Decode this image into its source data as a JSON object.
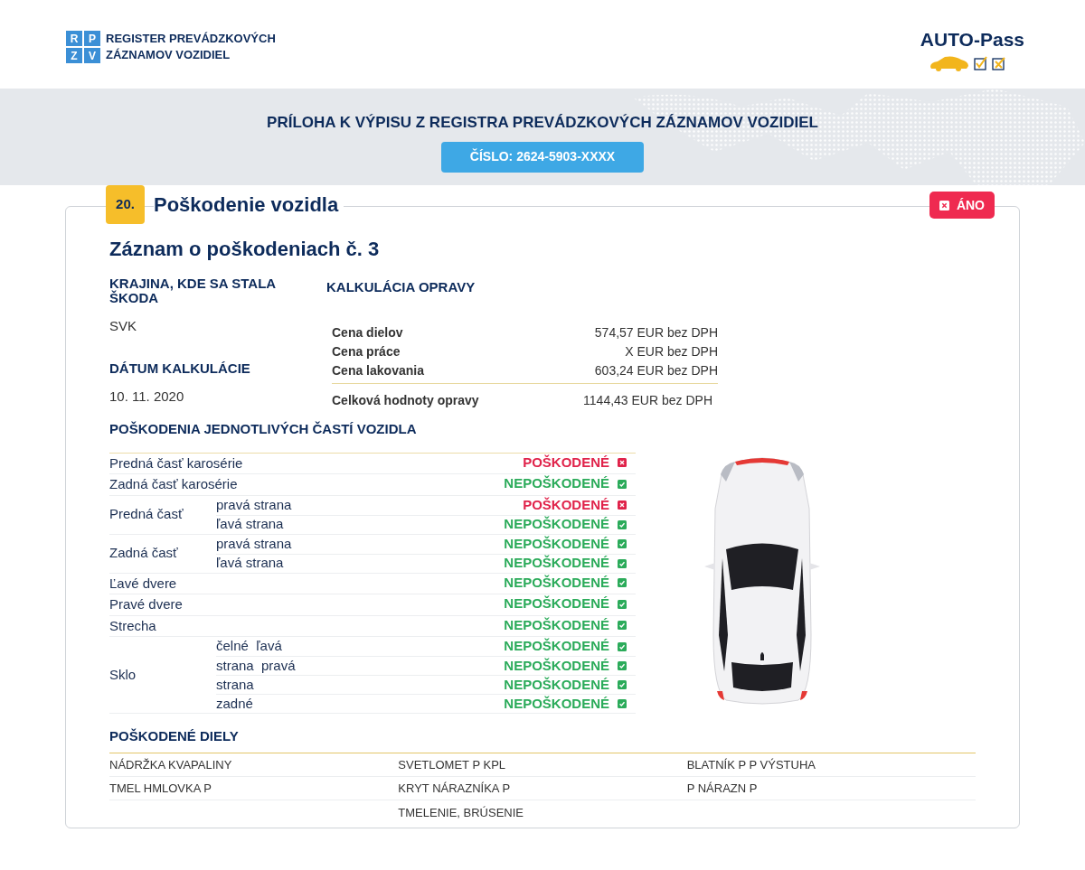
{
  "header": {
    "logo": {
      "letters": [
        "R",
        "P",
        "Z",
        "V"
      ],
      "text": "REGISTER PREVÁDZKOVÝCH ZÁZNAMOV VOZIDIEL"
    },
    "brand": "AUTO-Pass"
  },
  "banner": {
    "title": "PRÍLOHA K VÝPISU Z REGISTRA PREVÁDZKOVÝCH ZÁZNAMOV VOZIDIEL",
    "number": "ČÍSLO: 2624-5903-XXXX"
  },
  "section": {
    "number": "20.",
    "title": "Poškodenie vozidla",
    "answer": {
      "label": "ÁNO",
      "positive": true
    }
  },
  "record": {
    "title": "Záznam o poškodeniach č. 3",
    "fields": [
      {
        "label": "KRAJINA, KDE SA STALA ŠKODA",
        "value": "SVK"
      },
      {
        "label": "DÁTUM KALKULÁCIE",
        "value": "10. 11. 2020"
      }
    ],
    "calculation": {
      "title": "KALKULÁCIA OPRAVY",
      "items": [
        {
          "label": "Cena dielov",
          "value": "574,57 EUR bez DPH"
        },
        {
          "label": "Cena práce",
          "value": "X EUR bez DPH"
        },
        {
          "label": "Cena lakovania",
          "value": "603,24 EUR bez DPH"
        }
      ],
      "total": {
        "label": "Celková hodnoty opravy",
        "value": "1144,43 EUR bez DPH"
      }
    },
    "parts_title": "POŠKODENIA JEDNOTLIVÝCH ČASTÍ VOZIDLA",
    "parts": [
      {
        "label": "Predná časť karosérie",
        "rows": [
          {
            "status": "POŠKODENÉ",
            "damaged": true
          }
        ]
      },
      {
        "label": "Zadná časť karosérie",
        "rows": [
          {
            "status": "NEPOŠKODENÉ",
            "damaged": false
          }
        ]
      },
      {
        "label": "Predná časť",
        "rows": [
          {
            "sub": "pravá strana",
            "status": "POŠKODENÉ",
            "damaged": true
          },
          {
            "sub": "ľavá strana",
            "status": "NEPOŠKODENÉ",
            "damaged": false
          }
        ]
      },
      {
        "label": "Zadná časť",
        "rows": [
          {
            "sub": "pravá strana",
            "status": "NEPOŠKODENÉ",
            "damaged": false
          },
          {
            "sub": "ľavá strana",
            "status": "NEPOŠKODENÉ",
            "damaged": false
          }
        ]
      },
      {
        "label": "Ľavé dvere",
        "rows": [
          {
            "status": "NEPOŠKODENÉ",
            "damaged": false
          }
        ]
      },
      {
        "label": "Pravé dvere",
        "rows": [
          {
            "status": "NEPOŠKODENÉ",
            "damaged": false
          }
        ]
      },
      {
        "label": "Strecha",
        "rows": [
          {
            "status": "NEPOŠKODENÉ",
            "damaged": false
          }
        ]
      },
      {
        "label": "Sklo",
        "rows": [
          {
            "sub": "čelné  ľavá",
            "status": "NEPOŠKODENÉ",
            "damaged": false
          },
          {
            "sub": "strana  pravá",
            "status": "NEPOŠKODENÉ",
            "damaged": false
          },
          {
            "sub": "strana",
            "status": "NEPOŠKODENÉ",
            "damaged": false
          },
          {
            "sub": "zadné",
            "status": "NEPOŠKODENÉ",
            "damaged": false
          }
        ]
      }
    ],
    "damaged_parts": {
      "title": "POŠKODENÉ DIELY",
      "columns": [
        [
          "NÁDRŽKA KVAPALINY",
          "TMEL HMLOVKA P"
        ],
        [
          "SVETLOMET P KPL",
          "KRYT NÁRAZNÍKA P",
          "TMELENIE, BRÚSENIE"
        ],
        [
          "BLATNÍK P P VÝSTUHA",
          "P NÁRAZN P"
        ]
      ]
    }
  }
}
